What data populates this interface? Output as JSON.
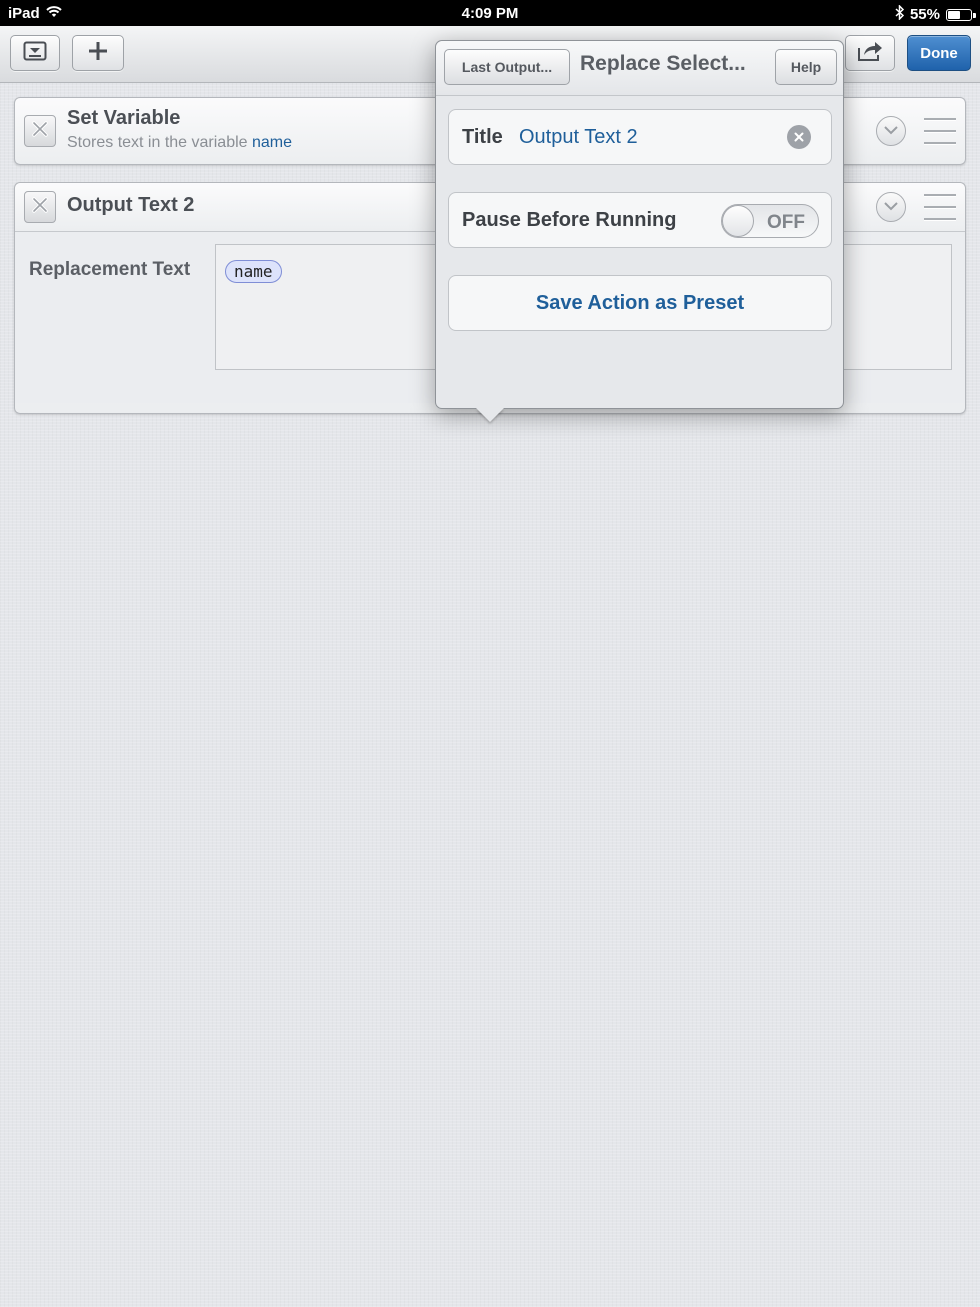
{
  "status_bar": {
    "device": "iPad",
    "time": "4:09 PM",
    "battery": "55%",
    "battery_level": 0.55
  },
  "toolbar": {
    "done_label": "Done"
  },
  "actions": [
    {
      "title": "Set Variable",
      "subtitle_prefix": "Stores text in the variable",
      "variable": "name"
    },
    {
      "title": "Output Text 2",
      "field_label": "Replacement Text",
      "token": "name"
    }
  ],
  "popover": {
    "last_output_label": "Last Output...",
    "title": "Replace Select...",
    "help_label": "Help",
    "title_label": "Title",
    "title_value": "Output Text 2",
    "pause_label": "Pause Before Running",
    "toggle_state": "OFF",
    "save_preset_label": "Save Action as Preset"
  },
  "colors": {
    "accent": "#1f5f9a",
    "done_button": "#2b6fb5",
    "token_fill": "#dde3fb"
  }
}
